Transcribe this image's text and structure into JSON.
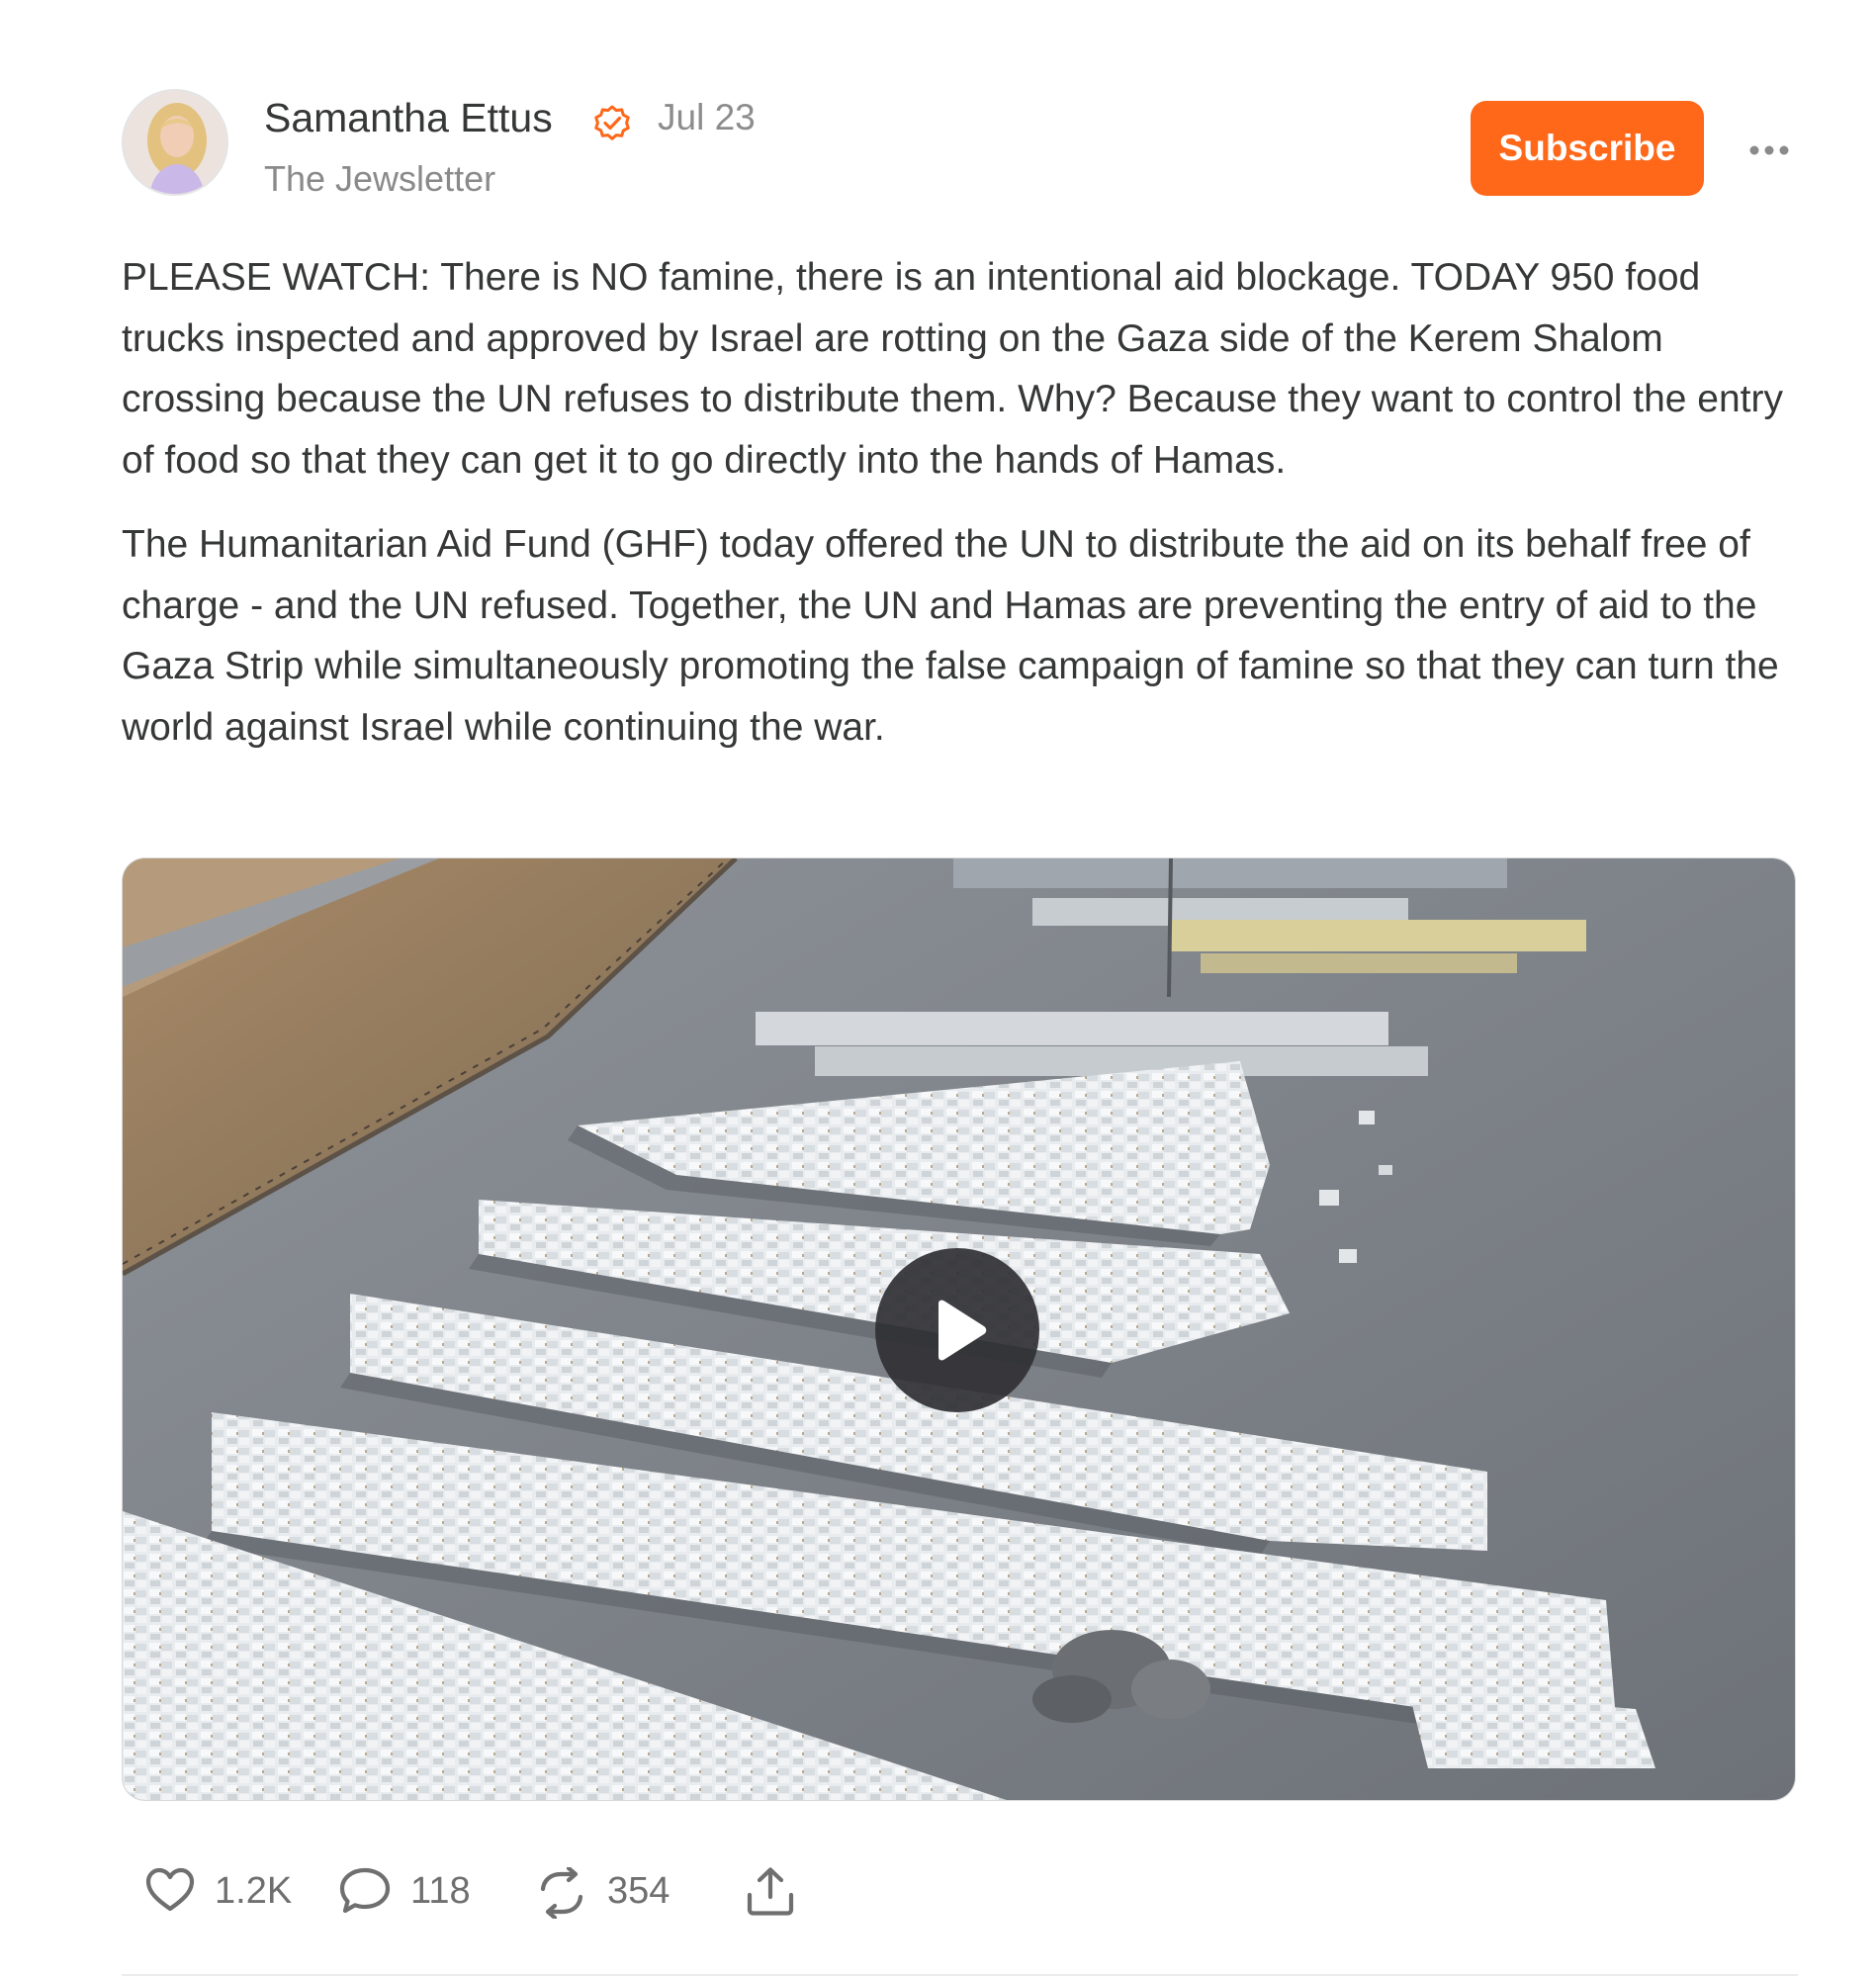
{
  "author": {
    "name": "Samantha Ettus",
    "date": "Jul 23",
    "publication": "The Jewsletter",
    "verified": true
  },
  "header": {
    "subscribe_label": "Subscribe",
    "more_icon": "ellipsis-icon"
  },
  "body": {
    "paragraphs": [
      "PLEASE WATCH: There is NO famine, there is an intentional aid blockage. TODAY 950 food trucks inspected and approved by Israel are rotting on the Gaza side of the Kerem Shalom crossing because the UN refuses to distribute them. Why? Because they want to control the entry of food so that they can get it to go directly into the hands of Hamas.",
      "The Humanitarian Aid Fund (GHF) today offered the UN to distribute the aid on its behalf free of charge - and the UN refused. Together, the UN and Hamas are preventing the entry of aid to the Gaza Strip while simultaneously promoting the false campaign of famine so that they can turn the world against Israel while continuing the war."
    ]
  },
  "video": {
    "play_icon": "play-icon"
  },
  "actions": {
    "likes": "1.2K",
    "comments": "118",
    "restacks": "354",
    "share_icon": "share-icon"
  },
  "colors": {
    "accent": "#ff6719",
    "text": "#363737",
    "muted": "#8a8a8a"
  }
}
